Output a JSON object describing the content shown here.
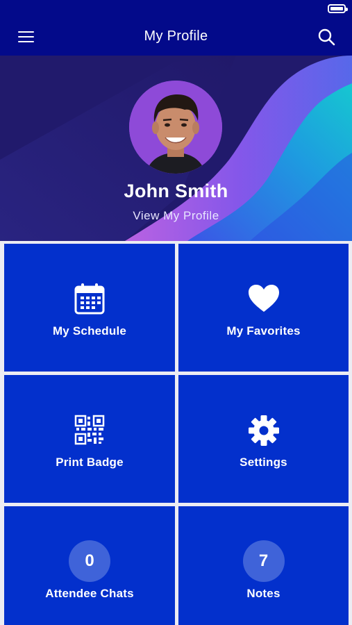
{
  "header": {
    "title": "My Profile",
    "menu_icon": "hamburger-menu-icon",
    "search_icon": "search-icon"
  },
  "profile": {
    "name": "John Smith",
    "link_label": "View My Profile"
  },
  "tiles": [
    {
      "label": "My Schedule",
      "icon": "calendar-icon"
    },
    {
      "label": "My Favorites",
      "icon": "heart-icon"
    },
    {
      "label": "Print Badge",
      "icon": "qr-code-icon"
    },
    {
      "label": "Settings",
      "icon": "gear-icon"
    },
    {
      "label": "Attendee Chats",
      "count": "0"
    },
    {
      "label": "Notes",
      "count": "7"
    }
  ],
  "colors": {
    "nav": "#030a8a",
    "tile": "#0330cc",
    "count_circle": "#3f63d9"
  }
}
